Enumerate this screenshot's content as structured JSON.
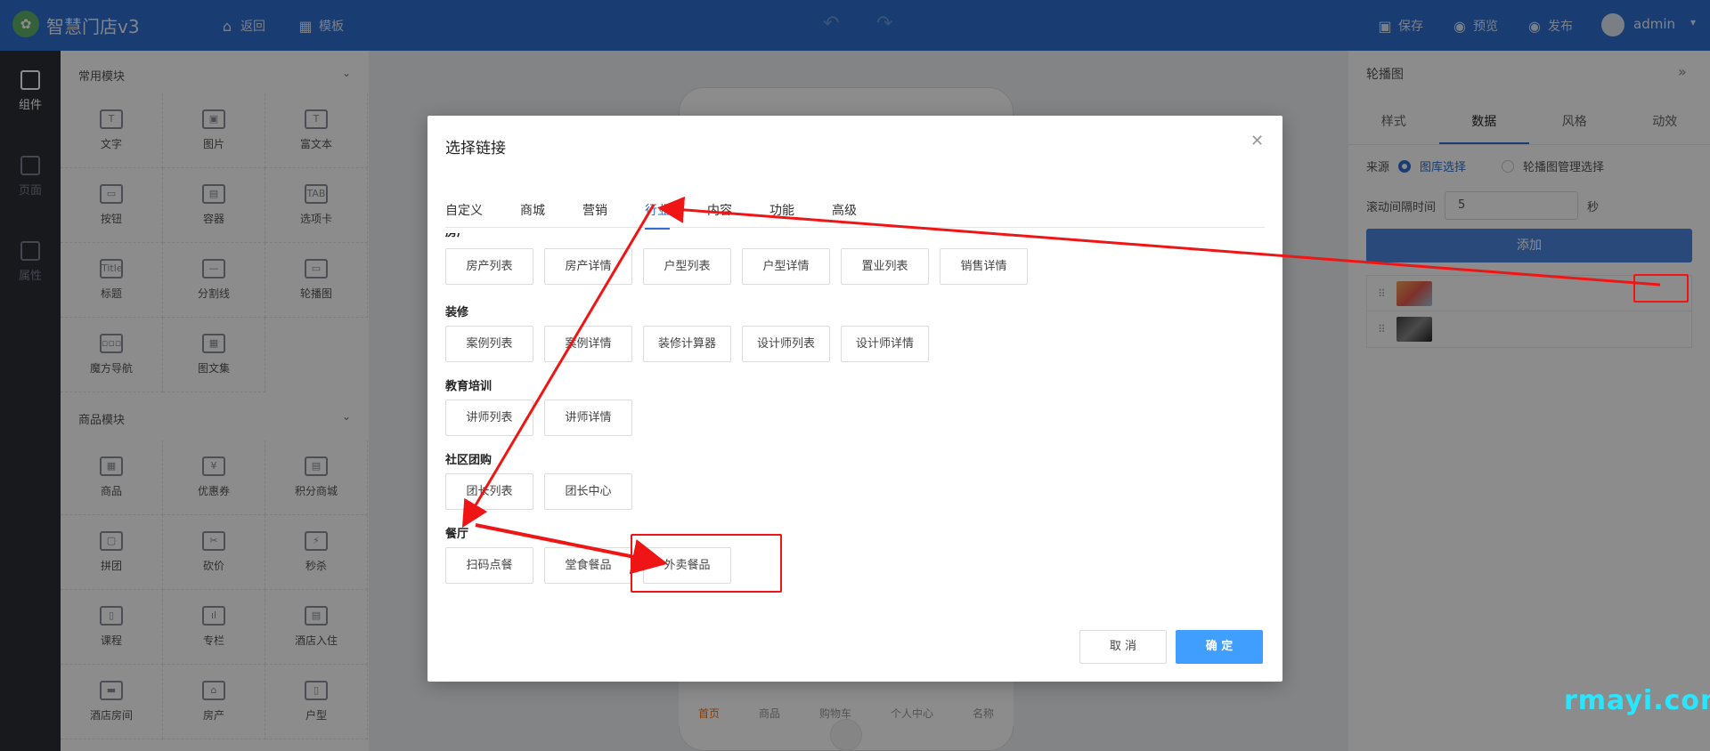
{
  "app": {
    "brand": "智慧门店v3",
    "user": "admin"
  },
  "topbar": {
    "nav": [
      {
        "icon": "home-icon",
        "label": "返回"
      },
      {
        "icon": "grid-icon",
        "label": "模板"
      }
    ],
    "actions": [
      {
        "icon": "save-icon",
        "label": "保存"
      },
      {
        "icon": "eye-icon",
        "label": "预览"
      },
      {
        "icon": "eye-icon",
        "label": "发布"
      }
    ]
  },
  "rail": [
    {
      "label": "组件",
      "active": true
    },
    {
      "label": "页面"
    },
    {
      "label": "属性"
    }
  ],
  "components": {
    "common": {
      "title": "常用模块",
      "items": [
        "文字",
        "图片",
        "富文本",
        "按钮",
        "容器",
        "选项卡",
        "标题",
        "分割线",
        "轮播图",
        "魔方导航",
        "图文集"
      ],
      "glyphs": [
        "T",
        "▣",
        "T",
        "▭",
        "▤",
        "TAB",
        "Title",
        "—",
        "▭",
        "▫▫▫",
        "▦"
      ]
    },
    "goods": {
      "title": "商品模块",
      "items": [
        "商品",
        "优惠券",
        "积分商城",
        "拼团",
        "砍价",
        "秒杀",
        "课程",
        "专栏",
        "酒店入住",
        "酒店房间",
        "房产",
        "户型"
      ],
      "glyphs": [
        "▦",
        "¥",
        "▤",
        "▢",
        "✂",
        "⚡",
        "▯",
        "ıl",
        "▤",
        "▬",
        "⌂",
        "▯"
      ]
    }
  },
  "phone": {
    "tabs": [
      "首页",
      "商品",
      "购物车",
      "个人中心",
      "名称"
    ]
  },
  "right_panel": {
    "title": "轮播图",
    "tabs": [
      "样式",
      "数据",
      "风格",
      "动效"
    ],
    "active_tab": "数据",
    "source_label": "来源",
    "source_options": [
      "图库选择",
      "轮播图管理选择"
    ],
    "interval_label": "滚动间隔时间",
    "interval_value": "5",
    "interval_unit": "秒",
    "add_button": "添加"
  },
  "dialog": {
    "title": "选择链接",
    "tabs": [
      "自定义",
      "商城",
      "营销",
      "行业",
      "内容",
      "功能",
      "高级"
    ],
    "active_tab": "行业",
    "sections": [
      {
        "title": "房产",
        "buttons": [
          "房产列表",
          "房产详情",
          "户型列表",
          "户型详情",
          "置业列表",
          "销售详情"
        ]
      },
      {
        "title": "装修",
        "buttons": [
          "案例列表",
          "案例详情",
          "装修计算器",
          "设计师列表",
          "设计师详情"
        ]
      },
      {
        "title": "教育培训",
        "buttons": [
          "讲师列表",
          "讲师详情"
        ]
      },
      {
        "title": "社区团购",
        "buttons": [
          "团长列表",
          "团长中心"
        ]
      },
      {
        "title": "餐厅",
        "buttons": [
          "扫码点餐",
          "堂食餐品",
          "外卖餐品"
        ]
      }
    ],
    "cancel": "取 消",
    "ok": "确 定"
  },
  "watermark": "rmayi.com",
  "colors": {
    "primary": "#2f6fcf",
    "annotation": "#f01515",
    "ok": "#409eff"
  }
}
